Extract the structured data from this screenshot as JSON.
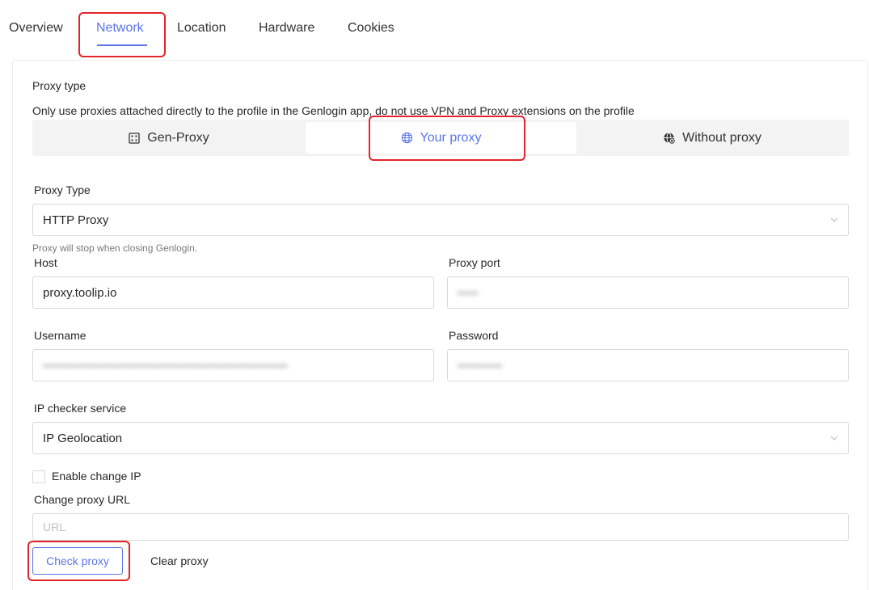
{
  "tabs": [
    {
      "label": "Overview"
    },
    {
      "label": "Network"
    },
    {
      "label": "Location"
    },
    {
      "label": "Hardware"
    },
    {
      "label": "Cookies"
    }
  ],
  "active_tab": "Network",
  "proxy_section": {
    "title": "Proxy type",
    "notice": "Only use proxies attached directly to the profile in the Genlogin app, do not use VPN and Proxy extensions on the profile",
    "modes": [
      {
        "label": "Gen-Proxy",
        "icon": "server-icon"
      },
      {
        "label": "Your proxy",
        "icon": "globe-icon"
      },
      {
        "label": "Without proxy",
        "icon": "globe-off-icon"
      }
    ],
    "active_mode": "Your proxy"
  },
  "form": {
    "proxy_type_label": "Proxy Type",
    "proxy_type_value": "HTTP Proxy",
    "proxy_hint": "Proxy will stop when closing Genlogin.",
    "host_label": "Host",
    "host_value": "proxy.toolip.io",
    "port_label": "Proxy port",
    "port_value": "•••••",
    "username_label": "Username",
    "username_value": "••••••••••••••••••••••••••••••••••••••••••••••••••••••••••••",
    "password_label": "Password",
    "password_value": "•••••••••••",
    "ip_checker_label": "IP checker service",
    "ip_checker_value": "IP Geolocation",
    "enable_change_ip_label": "Enable change IP",
    "enable_change_ip_checked": false,
    "change_proxy_url_label": "Change proxy URL",
    "change_proxy_url_placeholder": "URL"
  },
  "actions": {
    "check_proxy": "Check proxy",
    "clear_proxy": "Clear proxy"
  },
  "colors": {
    "accent": "#5b75e8",
    "highlight": "#e2242b"
  }
}
